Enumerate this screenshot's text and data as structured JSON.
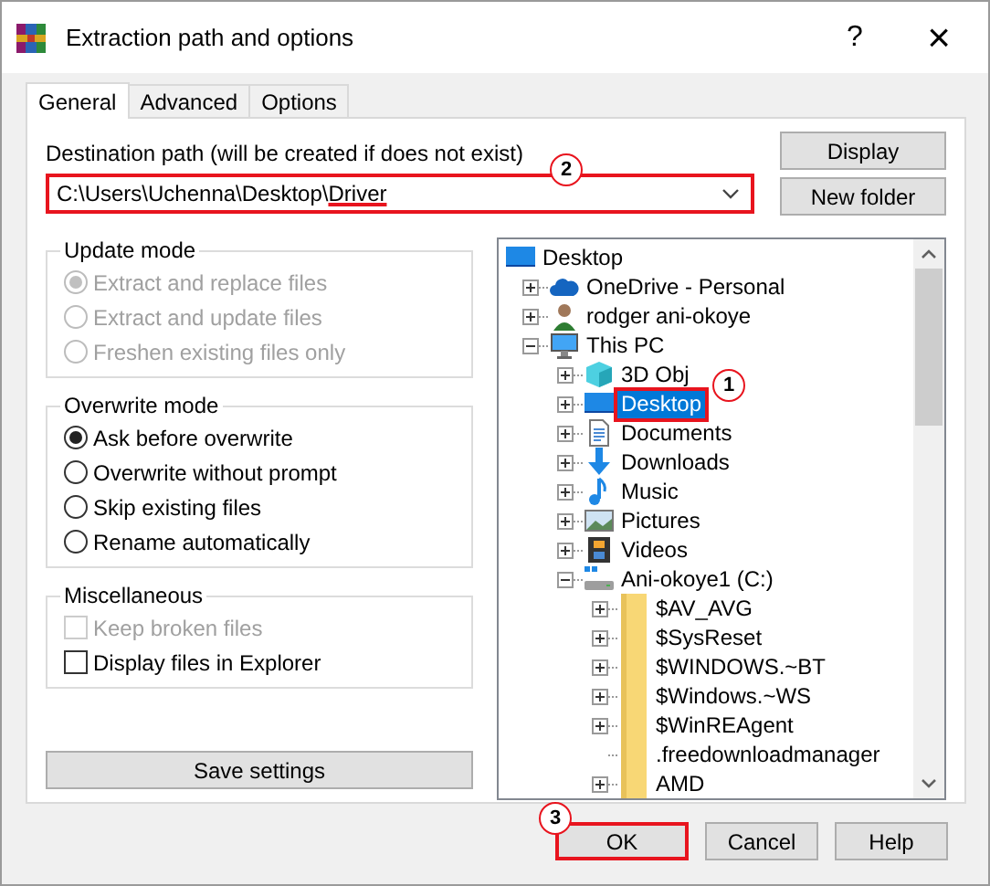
{
  "window": {
    "title": "Extraction path and options",
    "help": "?",
    "close": "×"
  },
  "tabs": [
    {
      "label": "General",
      "selected": true
    },
    {
      "label": "Advanced",
      "selected": false
    },
    {
      "label": "Options",
      "selected": false
    }
  ],
  "destination": {
    "label": "Destination path (will be created if does not exist)",
    "value_parts": [
      {
        "text": "C:\\Users\\Uchenna\\Desktop\\",
        "underlined": false
      },
      {
        "text": "Driver",
        "underlined": true
      }
    ],
    "marker": "2"
  },
  "side_buttons": [
    "Display",
    "New folder"
  ],
  "groups": [
    {
      "title": "Update mode",
      "options": [
        {
          "kind": "radio",
          "label": "Extract and replace files",
          "selected": true,
          "disabled": true
        },
        {
          "kind": "radio",
          "label": "Extract and update files",
          "selected": false,
          "disabled": true
        },
        {
          "kind": "radio",
          "label": "Freshen existing files only",
          "selected": false,
          "disabled": true
        }
      ]
    },
    {
      "title": "Overwrite mode",
      "options": [
        {
          "kind": "radio",
          "label": "Ask before overwrite",
          "selected": true,
          "disabled": false
        },
        {
          "kind": "radio",
          "label": "Overwrite without prompt",
          "selected": false,
          "disabled": false
        },
        {
          "kind": "radio",
          "label": "Skip existing files",
          "selected": false,
          "disabled": false
        },
        {
          "kind": "radio",
          "label": "Rename automatically",
          "selected": false,
          "disabled": false
        }
      ]
    },
    {
      "title": "Miscellaneous",
      "options": [
        {
          "kind": "checkbox",
          "label": "Keep broken files",
          "checked": false,
          "disabled": true
        },
        {
          "kind": "checkbox",
          "label": "Display files in Explorer",
          "checked": false,
          "disabled": false
        }
      ]
    }
  ],
  "save_button": "Save settings",
  "tree": [
    {
      "label": "Desktop",
      "kind": "desktop",
      "expandable": false,
      "selected": false,
      "children": [
        {
          "label": "OneDrive - Personal",
          "kind": "cloud",
          "expandable": true,
          "expanded": false,
          "selected": false
        },
        {
          "label": "rodger ani-okoye",
          "kind": "user",
          "expandable": true,
          "expanded": false,
          "selected": false
        },
        {
          "label": "This PC",
          "kind": "pc",
          "expandable": true,
          "expanded": true,
          "selected": false,
          "children": [
            {
              "label": "3D Obj",
              "kind": "cube",
              "expandable": true,
              "expanded": false,
              "selected": false
            },
            {
              "label": "Desktop",
              "kind": "desktop",
              "expandable": true,
              "expanded": false,
              "selected": true,
              "marker": "1"
            },
            {
              "label": "Documents",
              "kind": "document",
              "expandable": true,
              "expanded": false,
              "selected": false
            },
            {
              "label": "Downloads",
              "kind": "download",
              "expandable": true,
              "expanded": false,
              "selected": false
            },
            {
              "label": "Music",
              "kind": "music",
              "expandable": true,
              "expanded": false,
              "selected": false
            },
            {
              "label": "Pictures",
              "kind": "pictures",
              "expandable": true,
              "expanded": false,
              "selected": false
            },
            {
              "label": "Videos",
              "kind": "videos",
              "expandable": true,
              "expanded": false,
              "selected": false
            },
            {
              "label": "Ani-okoye1 (C:)",
              "kind": "drive",
              "expandable": true,
              "expanded": true,
              "selected": false,
              "children": [
                {
                  "label": "$AV_AVG",
                  "kind": "folder",
                  "expandable": true,
                  "expanded": false,
                  "selected": false
                },
                {
                  "label": "$SysReset",
                  "kind": "folder",
                  "expandable": true,
                  "expanded": false,
                  "selected": false
                },
                {
                  "label": "$WINDOWS.~BT",
                  "kind": "folder",
                  "expandable": true,
                  "expanded": false,
                  "selected": false
                },
                {
                  "label": "$Windows.~WS",
                  "kind": "folder",
                  "expandable": true,
                  "expanded": false,
                  "selected": false
                },
                {
                  "label": "$WinREAgent",
                  "kind": "folder",
                  "expandable": true,
                  "expanded": false,
                  "selected": false
                },
                {
                  "label": ".freedownloadmanager",
                  "kind": "folder",
                  "expandable": false,
                  "selected": false
                },
                {
                  "label": "AMD",
                  "kind": "folder",
                  "expandable": true,
                  "expanded": false,
                  "selected": false
                }
              ]
            }
          ]
        }
      ]
    }
  ],
  "footer_buttons": [
    {
      "label": "OK",
      "marker": "3"
    },
    {
      "label": "Cancel"
    },
    {
      "label": "Help"
    }
  ]
}
